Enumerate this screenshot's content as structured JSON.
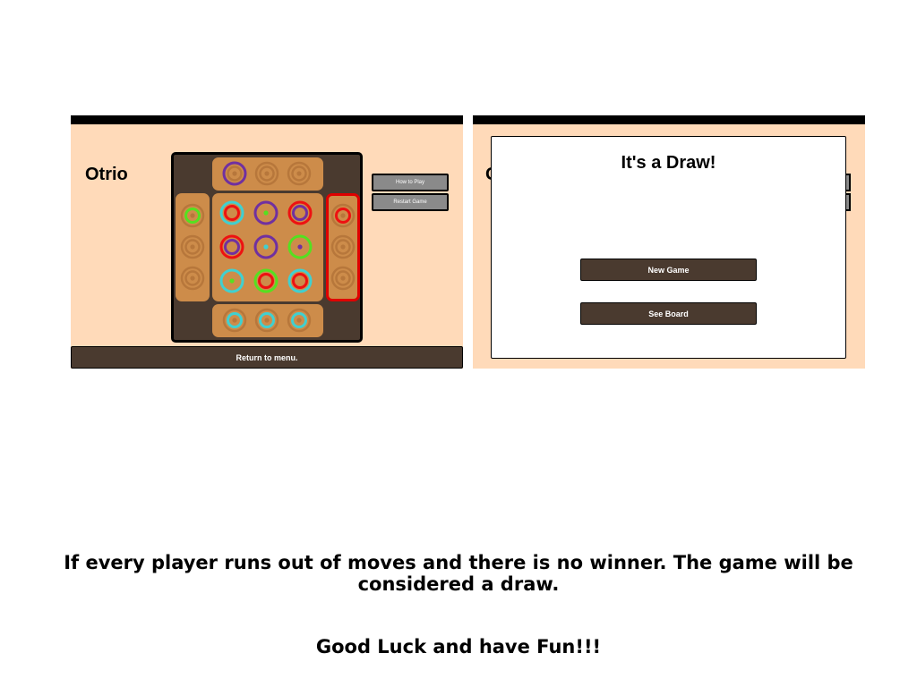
{
  "colors": {
    "panel_bg": "#ffdab9",
    "board_bg": "#4a3a2f",
    "tray": "#cd8c4a",
    "tray_piece": "#b7773b",
    "purple": "#7030a0",
    "red": "#ee1111",
    "green": "#55e020",
    "cyan": "#40d0d0",
    "highlight": "#e00000"
  },
  "left_panel": {
    "title": "Otrio",
    "how_to_play": "How to Play",
    "restart_game": "Restart Game",
    "return_menu": "Return to menu."
  },
  "right_panel": {
    "behind_title": "O",
    "modal": {
      "title": "It's a Draw!",
      "new_game": "New Game",
      "see_board": "See Board"
    }
  },
  "board": {
    "top_tray": [
      [
        "purple",
        null,
        null,
        "tray"
      ],
      [
        null,
        null,
        null,
        "tray"
      ],
      [
        null,
        null,
        null,
        "tray"
      ]
    ],
    "bottom_tray": [
      [
        null,
        "cyan",
        null,
        "tray"
      ],
      [
        null,
        "cyan",
        null,
        "tray"
      ],
      [
        null,
        "cyan",
        null,
        "tray"
      ]
    ],
    "left_tray": [
      [
        null,
        "green",
        null,
        "tray"
      ],
      [
        null,
        null,
        null,
        "tray"
      ],
      [
        null,
        null,
        null,
        "tray"
      ]
    ],
    "right_tray": [
      [
        null,
        "red",
        null,
        "tray"
      ],
      [
        null,
        null,
        null,
        "tray"
      ],
      [
        null,
        null,
        null,
        "tray"
      ]
    ],
    "grid": [
      [
        [
          "cyan",
          "red",
          null
        ],
        [
          "purple",
          null,
          "green"
        ],
        [
          "red",
          "purple",
          null
        ]
      ],
      [
        [
          "red",
          "purple",
          null
        ],
        [
          "purple",
          null,
          "cyan"
        ],
        [
          "green",
          null,
          "purple"
        ]
      ],
      [
        [
          "cyan",
          null,
          "green"
        ],
        [
          "green",
          "red",
          null
        ],
        [
          "cyan",
          "red",
          null
        ]
      ]
    ]
  },
  "captions": {
    "rule": "If every player runs out of moves and there is no winner. The game will be considered a draw.",
    "luck": "Good Luck and have Fun!!!"
  }
}
